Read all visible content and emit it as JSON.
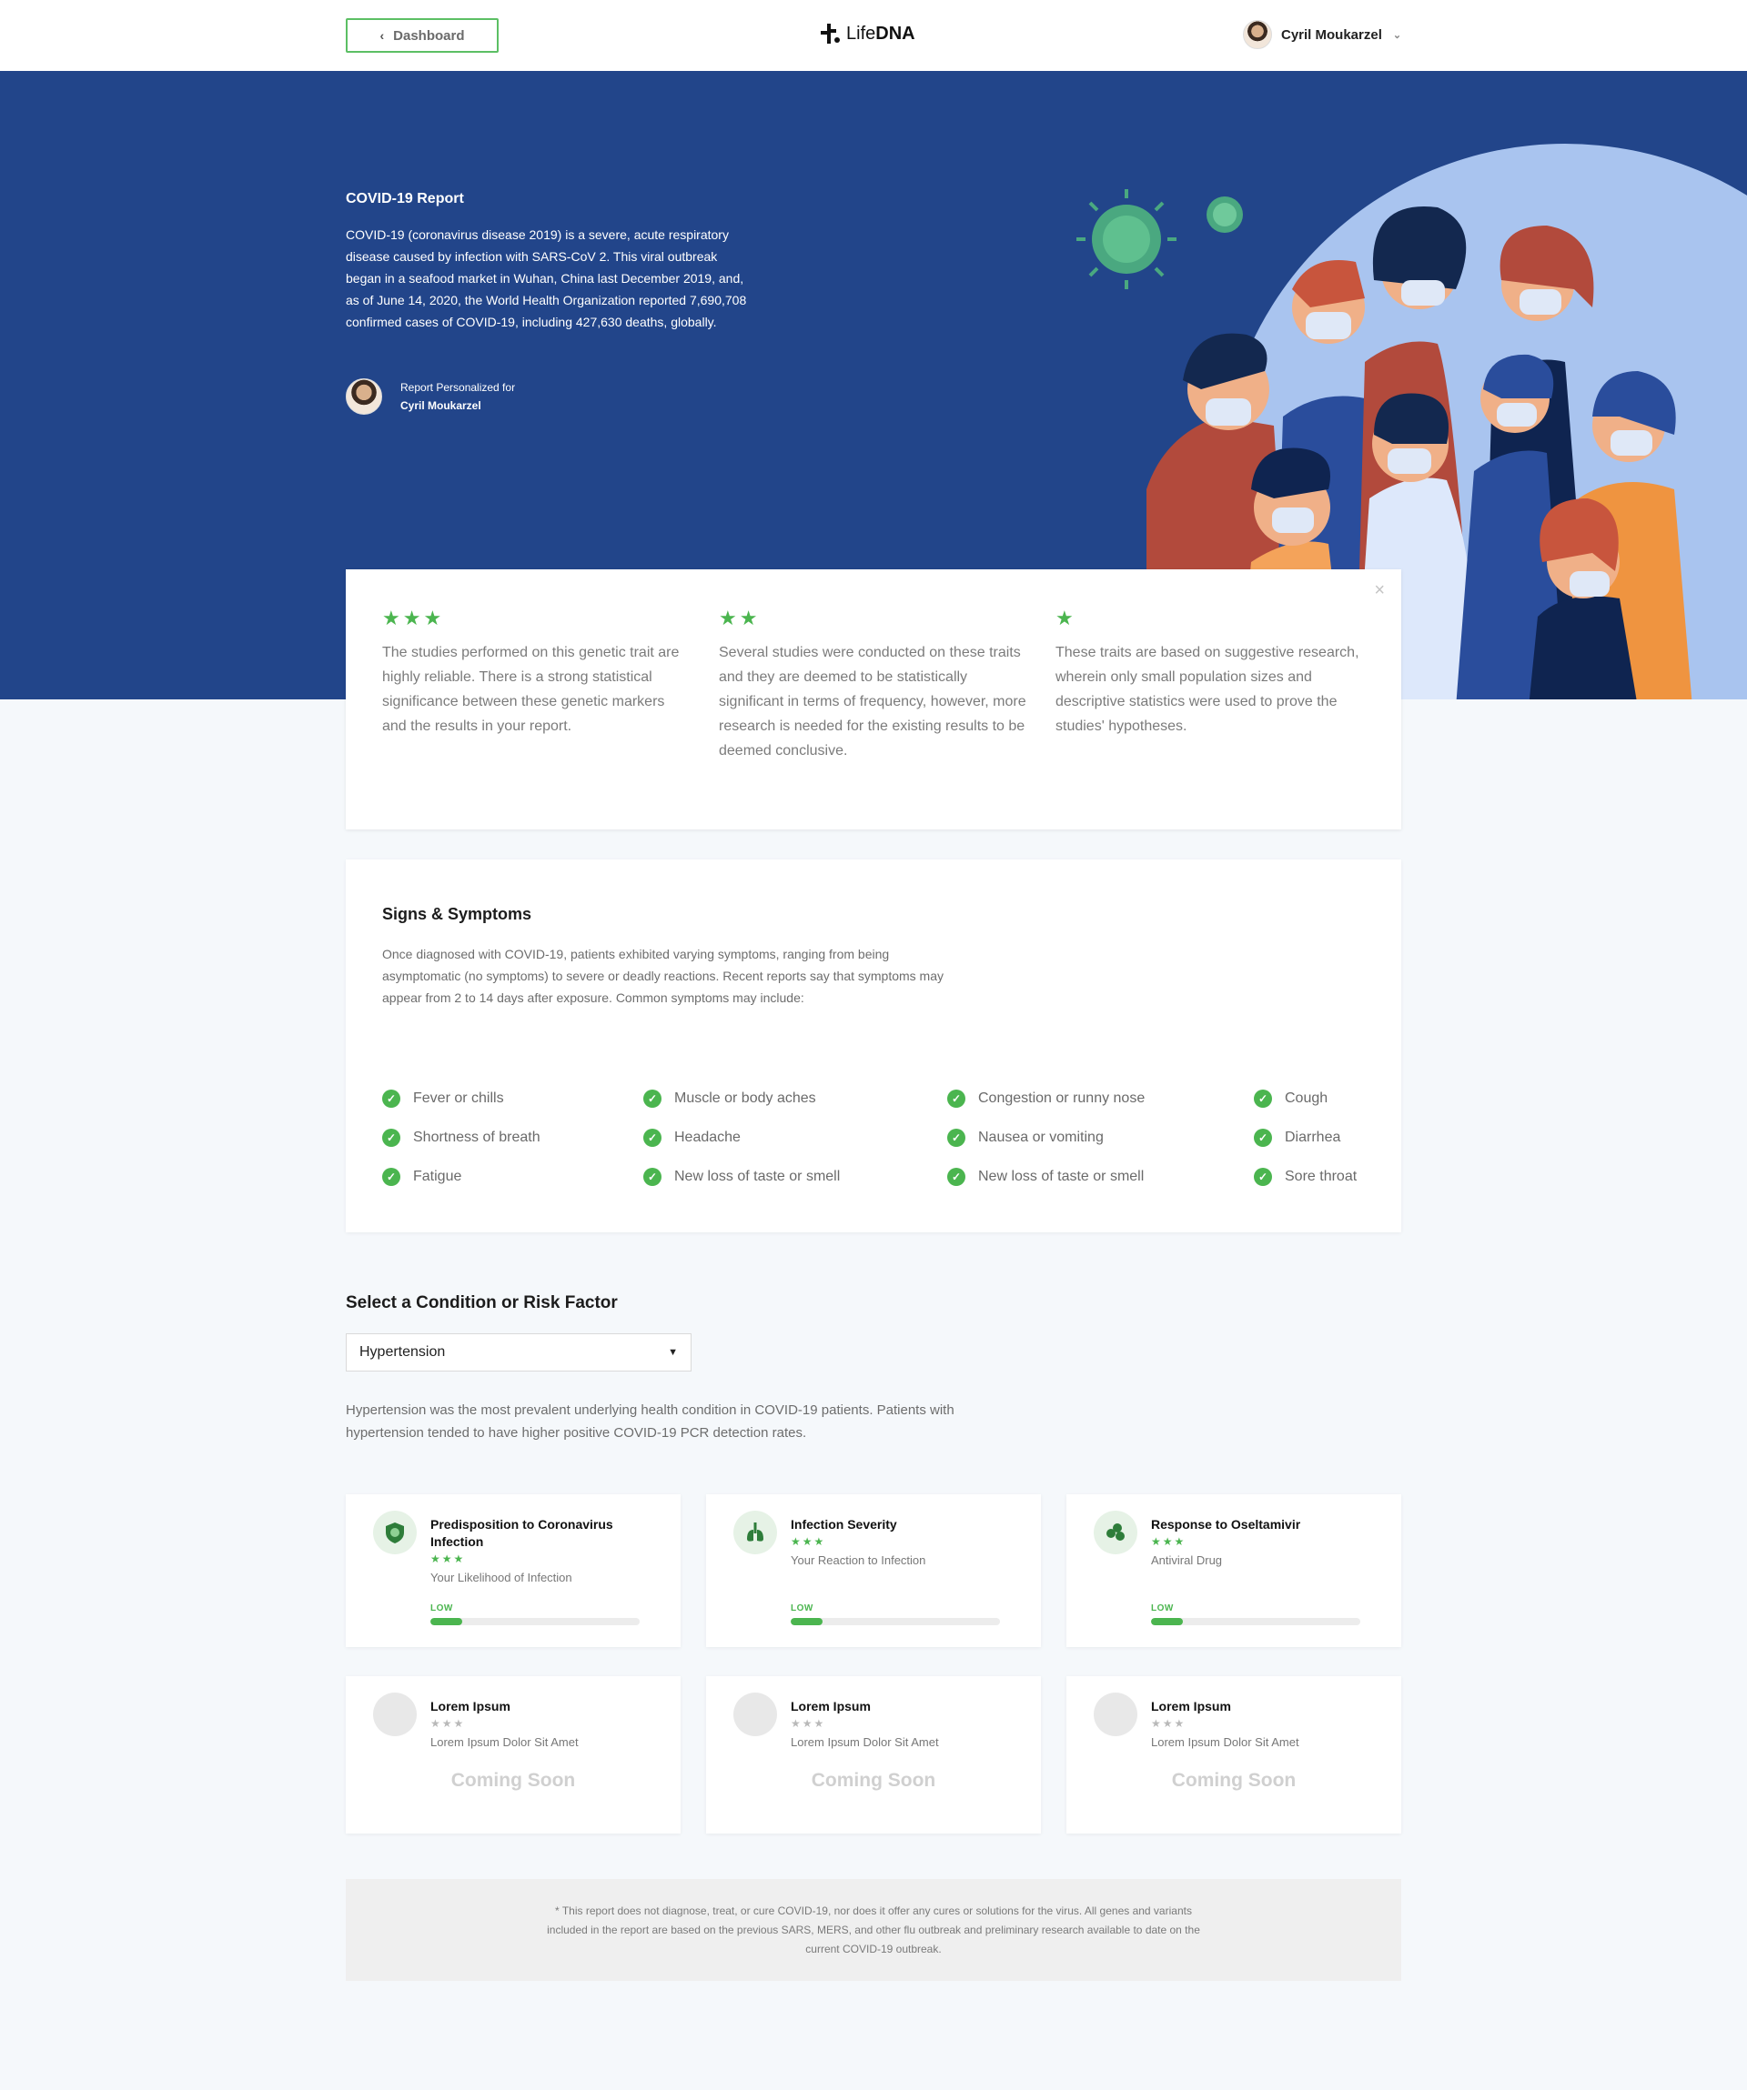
{
  "header": {
    "back_label": "Dashboard",
    "logo_light": "Life",
    "logo_bold": "DNA",
    "user_name": "Cyril Moukarzel"
  },
  "hero": {
    "title": "COVID-19 Report",
    "text": "COVID-19 (coronavirus disease 2019) is a severe, acute respiratory disease caused by infection with SARS-CoV 2. This viral outbreak began in a seafood market in Wuhan, China last December 2019, and, as of June 14, 2020, the World Health Organization reported 7,690,708 confirmed cases of COVID-19, including 427,630 deaths, globally.",
    "personalized_label": "Report Personalized for",
    "personalized_name": "Cyril Moukarzel"
  },
  "evidence": {
    "close": "×",
    "items": [
      {
        "stars": "★★★",
        "text": "The studies performed on this genetic trait are highly reliable. There is a strong statistical significance between these genetic markers and the results in your report."
      },
      {
        "stars": "★★",
        "text": "Several studies were conducted on these traits and they are deemed to be statistically significant in terms of frequency, however, more research is needed for the existing results to be deemed conclusive."
      },
      {
        "stars": "★",
        "text": "These traits are based on suggestive research, wherein only small population sizes and descriptive statistics were used to prove the studies' hypotheses."
      }
    ]
  },
  "symptoms": {
    "title": "Signs & Symptoms",
    "description": "Once diagnosed with COVID-19, patients exhibited varying symptoms, ranging from being asymptomatic (no symptoms) to severe or deadly reactions. Recent reports say that symptoms may appear from 2 to 14 days after exposure. Common symptoms may include:",
    "check_glyph": "✓",
    "items": [
      "Fever or chills",
      "Muscle or body aches",
      "Congestion or runny nose",
      "Cough",
      "Shortness of breath",
      "Headache",
      "Nausea or vomiting",
      "Diarrhea",
      "Fatigue",
      "New loss of taste or smell",
      "New loss of taste or smell",
      "Sore throat"
    ]
  },
  "condition": {
    "title": "Select a Condition or Risk Factor",
    "selected": "Hypertension",
    "description": "Hypertension was the most prevalent underlying health condition in COVID-19 patients. Patients with hypertension tended to have higher positive COVID-19 PCR detection rates."
  },
  "traits": [
    {
      "title": "Predisposition to Coronavirus Infection",
      "stars": "★★★",
      "subtitle": "Your Likelihood of Infection",
      "level": "LOW",
      "level_fraction": 0.15,
      "icon": "virus-shield-icon"
    },
    {
      "title": "Infection Severity",
      "stars": "★★★",
      "subtitle": "Your Reaction to Infection",
      "level": "LOW",
      "level_fraction": 0.15,
      "icon": "lungs-icon"
    },
    {
      "title": "Response to Oseltamivir",
      "stars": "★★★",
      "subtitle": "Antiviral Drug",
      "level": "LOW",
      "level_fraction": 0.15,
      "icon": "pills-icon"
    }
  ],
  "coming_soon": [
    {
      "title": "Lorem Ipsum",
      "stars": "★★★",
      "subtitle": "Lorem Ipsum Dolor Sit Amet",
      "label": "Coming Soon"
    },
    {
      "title": "Lorem Ipsum",
      "stars": "★★★",
      "subtitle": "Lorem Ipsum Dolor Sit Amet",
      "label": "Coming Soon"
    },
    {
      "title": "Lorem Ipsum",
      "stars": "★★★",
      "subtitle": "Lorem Ipsum Dolor Sit Amet",
      "label": "Coming Soon"
    }
  ],
  "disclaimer": "* This report does not diagnose, treat, or cure COVID-19, nor does it offer any cures or solutions for the virus. All genes and variants included in the report are based on the previous SARS, MERS, and other flu outbreak and preliminary research available to date on the current COVID-19 outbreak.",
  "colors": {
    "hero_bg": "#22458a",
    "accent_green": "#4bb54f",
    "page_bg": "#f5f8fb"
  }
}
